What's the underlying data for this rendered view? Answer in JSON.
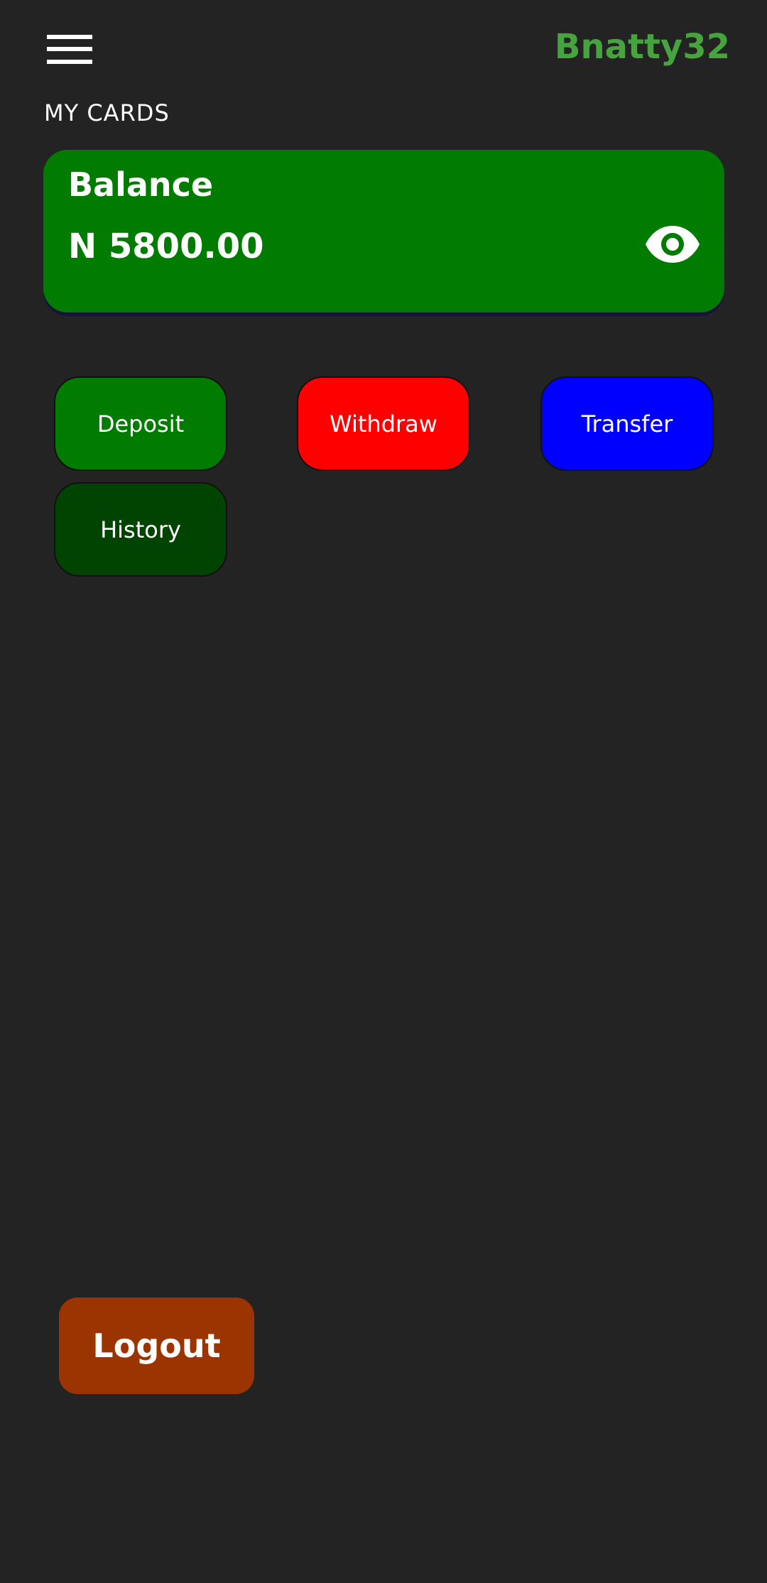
{
  "header": {
    "menu_icon": "hamburger-menu-icon",
    "username": "Bnatty32",
    "username_color": "#46a43f"
  },
  "section": {
    "title": "MY CARDS"
  },
  "balance_card": {
    "label": "Balance",
    "amount": "N 5800.00",
    "toggle_icon": "eye-icon",
    "color": "#017c01"
  },
  "actions": {
    "deposit": {
      "label": "Deposit",
      "color": "#017c01"
    },
    "withdraw": {
      "label": "Withdraw",
      "color": "#ff0000"
    },
    "transfer": {
      "label": "Transfer",
      "color": "#0000ff"
    },
    "history": {
      "label": "History",
      "color": "#014401"
    }
  },
  "logout": {
    "label": "Logout",
    "color": "#9b3400"
  }
}
